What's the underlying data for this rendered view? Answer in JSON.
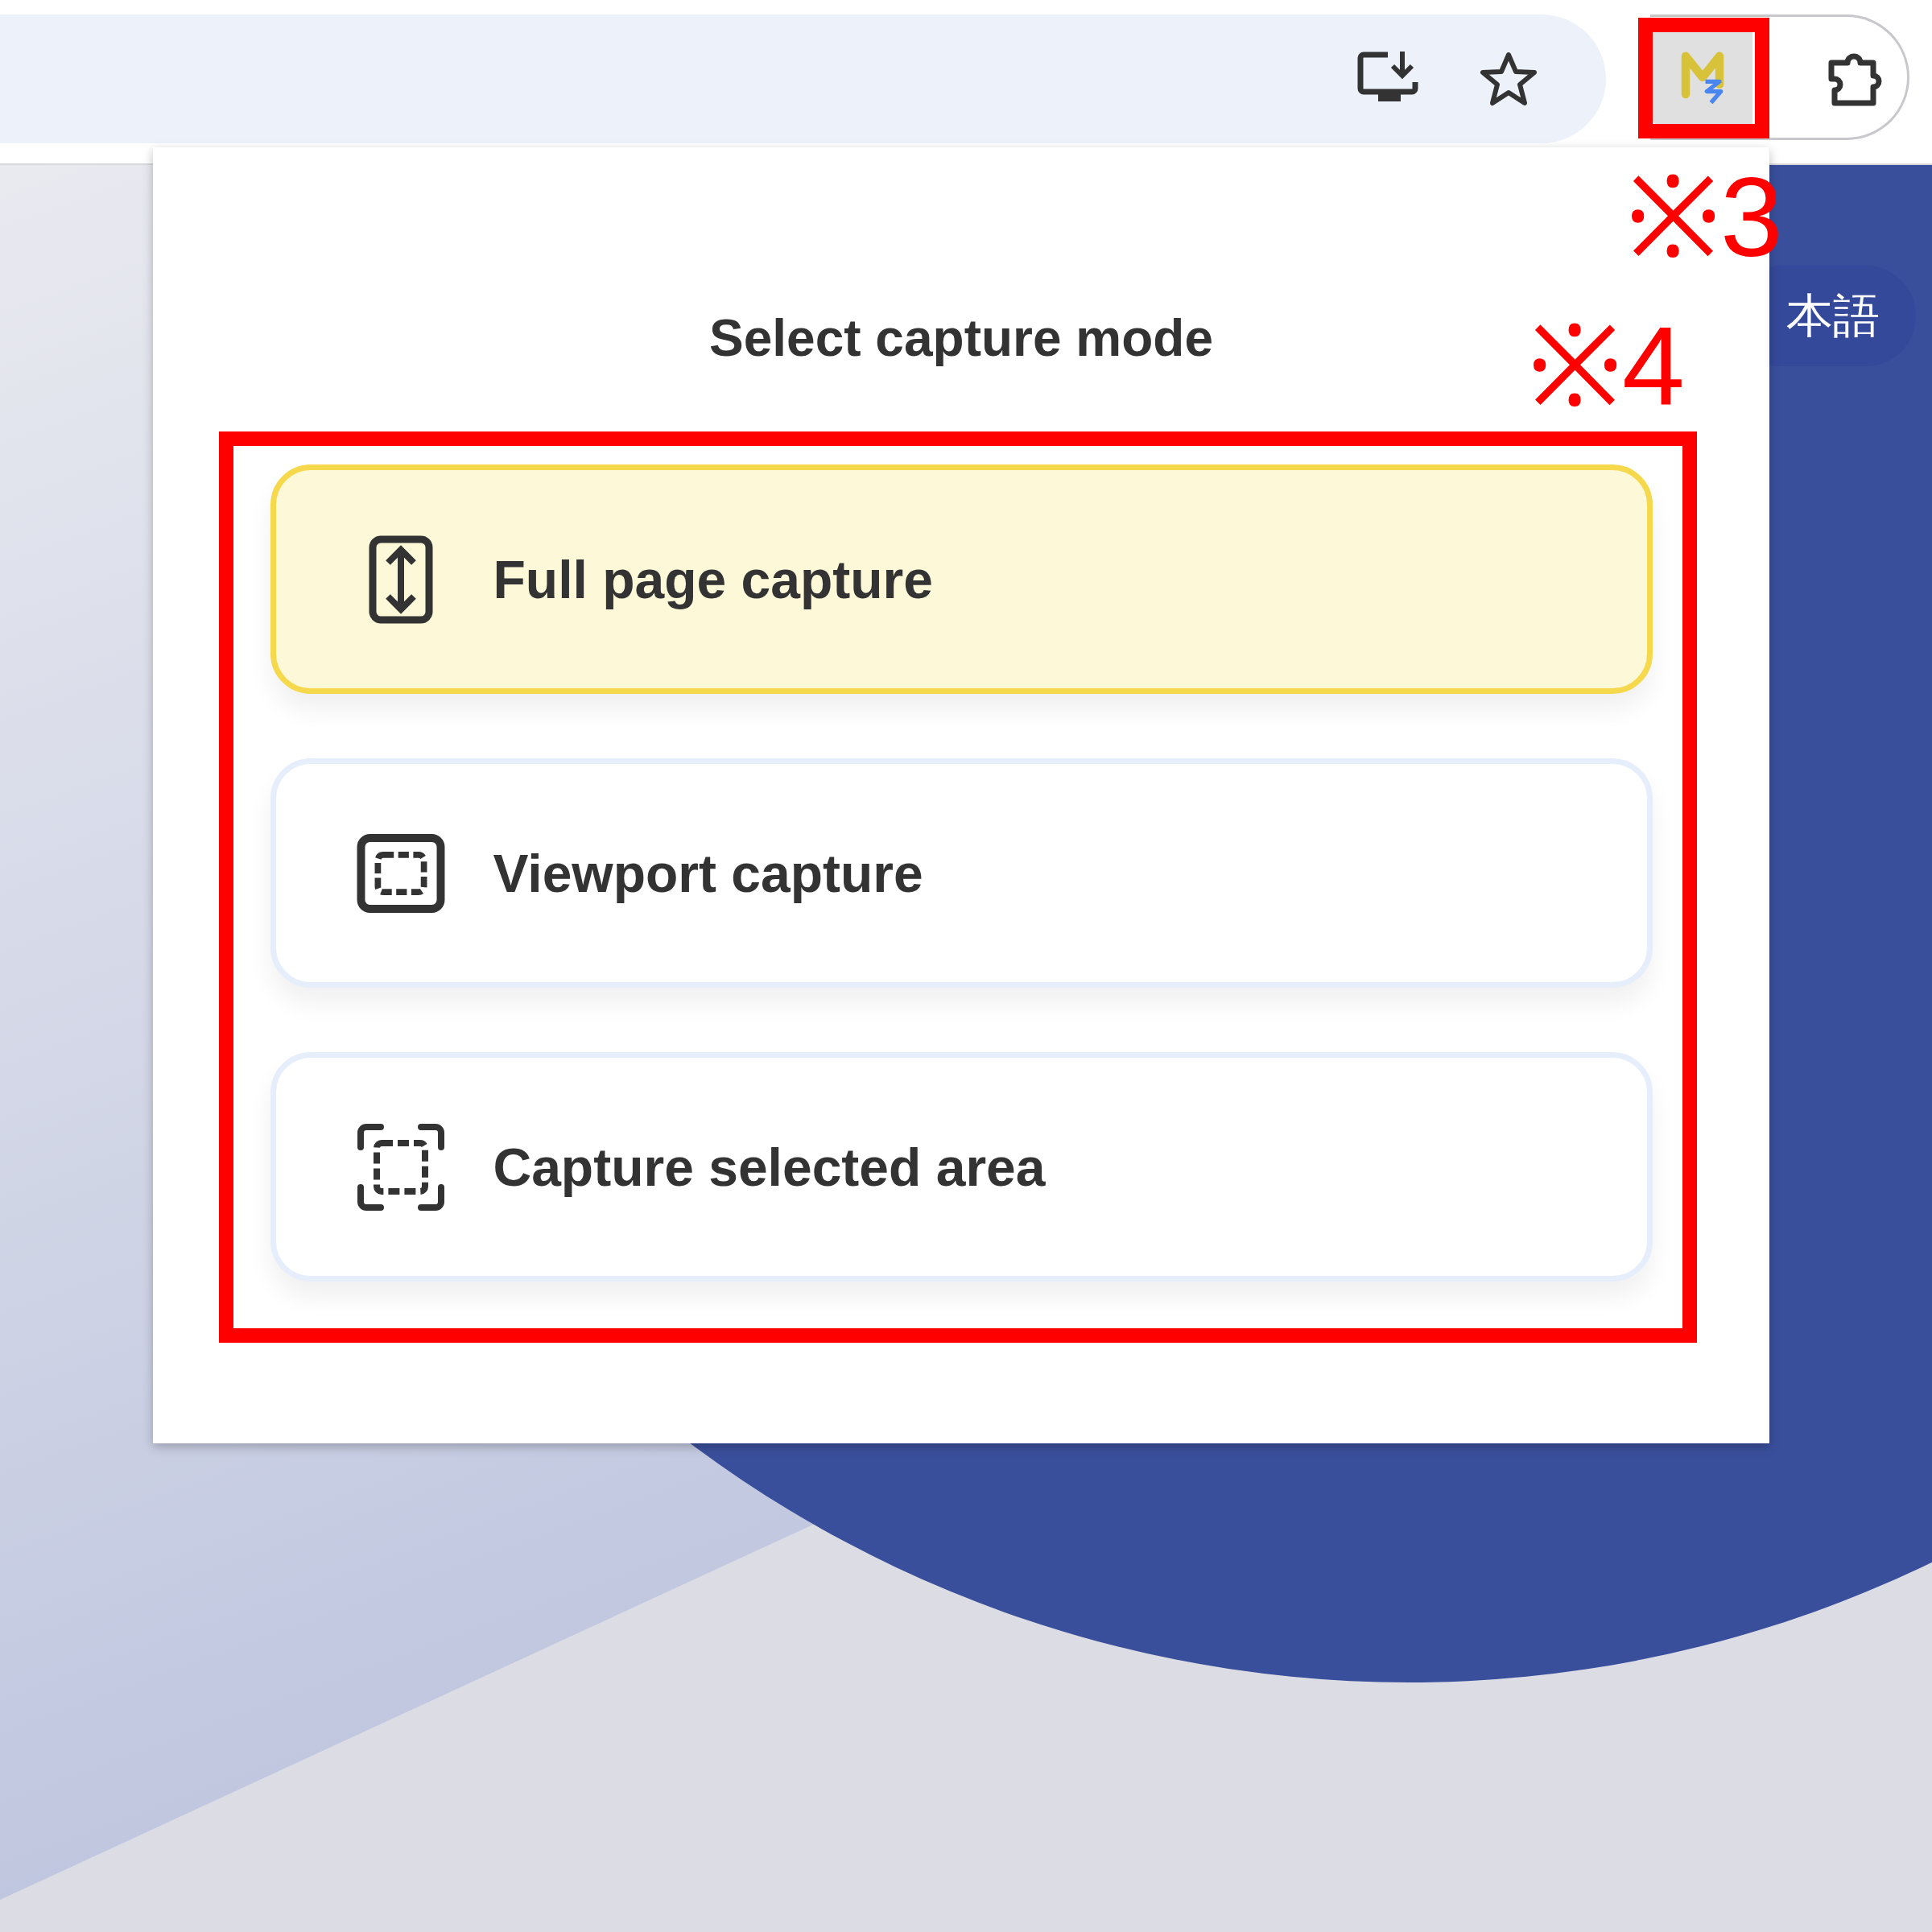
{
  "page": {
    "language_button": "本語"
  },
  "popup": {
    "title": "Select capture mode",
    "options": [
      {
        "label": "Full page capture",
        "kind": "full-page",
        "selected": true
      },
      {
        "label": "Viewport capture",
        "kind": "viewport",
        "selected": false
      },
      {
        "label": "Capture selected area",
        "kind": "area",
        "selected": false
      }
    ]
  },
  "annotations": [
    {
      "label": "※3",
      "kind": "extension"
    },
    {
      "label": "※4",
      "kind": "options"
    }
  ]
}
